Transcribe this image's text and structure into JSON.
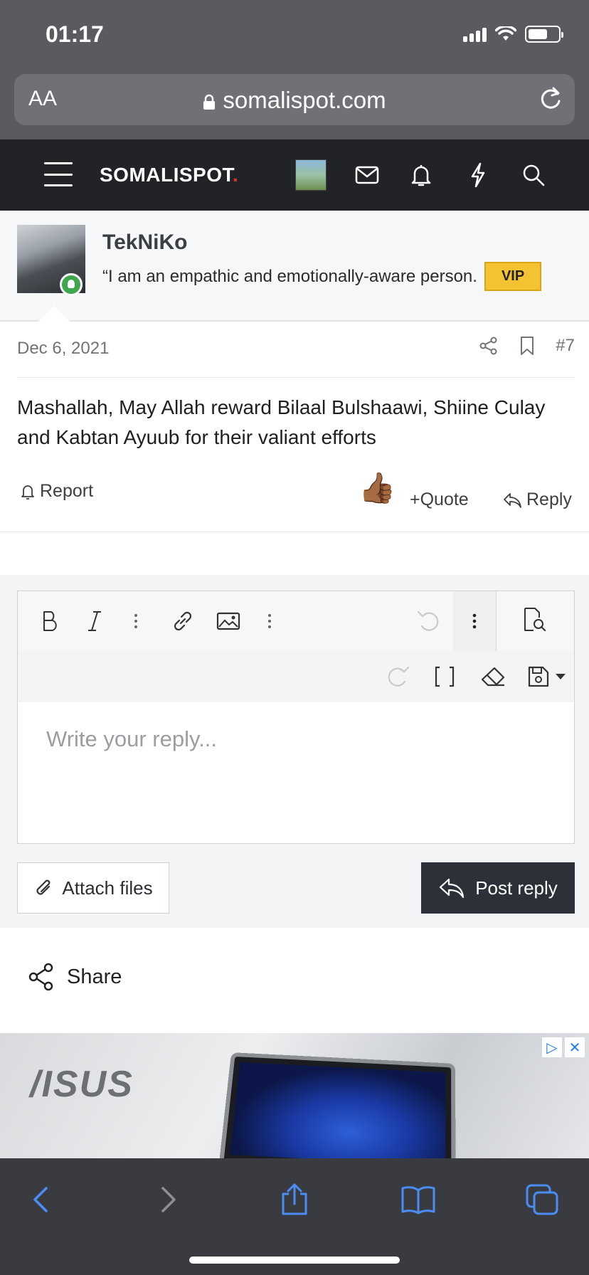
{
  "status_bar": {
    "time": "01:17"
  },
  "browser": {
    "text_size_label": "AA",
    "url": "somalispot.com"
  },
  "site_header": {
    "logo": "SOMALISPOT",
    "logo_dot": "."
  },
  "author": {
    "name": "TekNiKo",
    "title": "“I am an empathic and emotionally-aware person.",
    "badge": "VIP"
  },
  "post": {
    "date": "Dec 6, 2021",
    "number": "#7",
    "body": "Mashallah, May Allah reward Bilaal Bulshaawi, Shiine Culay and Kabtan Ayuub for their valiant efforts",
    "reaction_emoji": "👍🏾"
  },
  "actions": {
    "report": "Report",
    "quote": "Quote",
    "reply": "Reply"
  },
  "editor": {
    "placeholder": "Write your reply...",
    "attach_label": "Attach files",
    "post_reply_label": "Post reply"
  },
  "share_label": "Share",
  "ad": {
    "brand": "/ISUS"
  },
  "colors": {
    "vip": "#f5c332",
    "header": "#222326",
    "accent_red": "#d6322f",
    "browser_blue": "#4a8ef5"
  }
}
